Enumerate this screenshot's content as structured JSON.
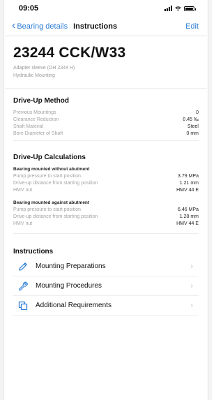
{
  "status_bar": {
    "time": "09:05"
  },
  "nav": {
    "back_label": "Bearing details",
    "title": "Instructions",
    "edit_label": "Edit"
  },
  "header": {
    "designation": "23244 CCK/W33",
    "subtitle_1": "Adapter sleeve (OH 2344 H)",
    "subtitle_2": "Hydraulic Mounting"
  },
  "drive_up_method": {
    "title": "Drive-Up Method",
    "rows": [
      {
        "label": "Previous Mountings",
        "value": "0"
      },
      {
        "label": "Clearance Reduction",
        "value": "0.45 ‰"
      },
      {
        "label": "Shaft Material",
        "value": "Steel"
      },
      {
        "label": "Bore Diameter of Shaft",
        "value": "0 mm"
      }
    ]
  },
  "drive_up_calculations": {
    "title": "Drive-Up Calculations",
    "groups": [
      {
        "title": "Bearing mounted without abutment",
        "rows": [
          {
            "label": "Pump pressure to start position",
            "value": "3.79 MPa"
          },
          {
            "label": "Drive-up distance from starting position",
            "value": "1.21 mm"
          },
          {
            "label": "HMV nut",
            "value": "HMV 44 E"
          }
        ]
      },
      {
        "title": "Bearing mounted against abutment",
        "rows": [
          {
            "label": "Pump pressure to start position",
            "value": "6.46 MPa"
          },
          {
            "label": "Drive-up distance from starting position",
            "value": "1.28 mm"
          },
          {
            "label": "HMV nut",
            "value": "HMV 44 E"
          }
        ]
      }
    ]
  },
  "instructions": {
    "title": "Instructions",
    "items": [
      {
        "label": "Mounting Preparations",
        "icon": "pencil-icon"
      },
      {
        "label": "Mounting Procedures",
        "icon": "wrench-icon"
      },
      {
        "label": "Additional Requirements",
        "icon": "copy-icon"
      }
    ]
  },
  "colors": {
    "accent": "#2f7fd6",
    "muted_text": "#a3a3a3",
    "divider": "#ededed"
  }
}
